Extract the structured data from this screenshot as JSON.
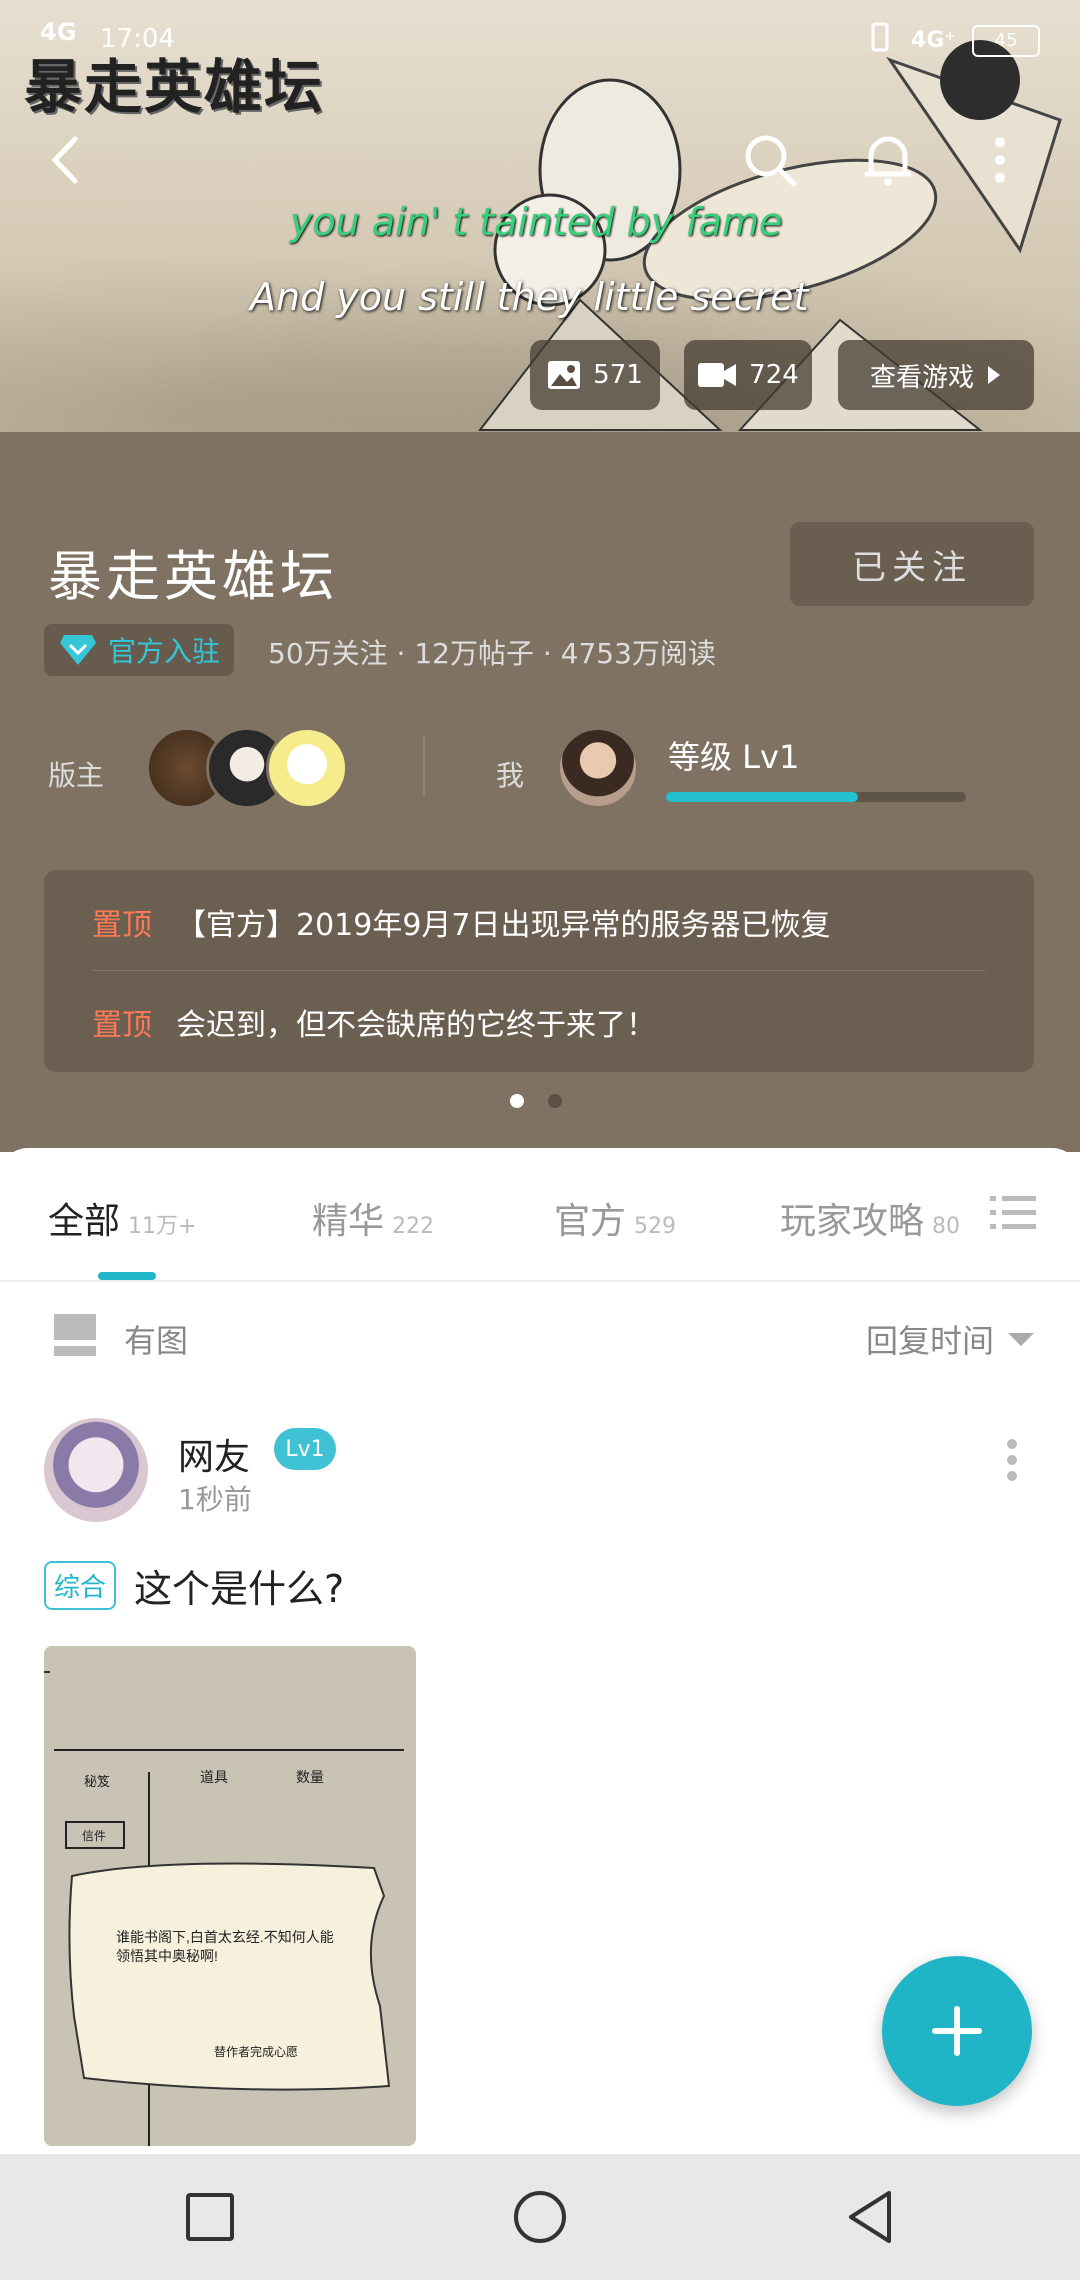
{
  "status_bar": {
    "network": "4G",
    "time": "17:04",
    "battery": "45"
  },
  "banner": {
    "logo_text": "暴走英雄坛",
    "lyric_line1": "you ain' t tainted by fame",
    "lyric_line2": "And you still they little secret",
    "images_count": "571",
    "videos_count": "724",
    "view_game_label": "查看游戏"
  },
  "forum": {
    "name": "暴走英雄坛",
    "follow_label": "已关注",
    "official_label": "官方入驻",
    "stats": "50万关注 · 12万帖子 · 4753万阅读",
    "moderators_label": "版主",
    "me_label": "我",
    "level_label": "等级 Lv1",
    "level_progress": 0.64
  },
  "pinned": [
    {
      "tag": "置顶",
      "text": "【官方】2019年9月7日出现异常的服务器已恢复"
    },
    {
      "tag": "置顶",
      "text": "会迟到，但不会缺席的它终于来了！"
    }
  ],
  "tabs": [
    {
      "label": "全部",
      "count": "11万+"
    },
    {
      "label": "精华",
      "count": "222"
    },
    {
      "label": "官方",
      "count": "529"
    },
    {
      "label": "玩家攻略",
      "count": "80"
    }
  ],
  "filter": {
    "with_image_label": "有图",
    "sort_label": "回复时间"
  },
  "post": {
    "username": "网友",
    "level": "Lv1",
    "time": "1秒前",
    "tag": "综合",
    "title": "这个是什么?",
    "image": {
      "tab1": "秘笈",
      "tab2": "道具",
      "tab3": "数量",
      "btn": "信件",
      "scroll_text1": "谁能书阁下,白首太玄经.不知何人能",
      "scroll_text2": "领悟其中奥秘啊!",
      "scroll_footer": "替作者完成心愿"
    }
  },
  "colors": {
    "accent": "#1fb7c9",
    "header_bg": "#7f7263",
    "pin_tag": "#ff7a52"
  }
}
